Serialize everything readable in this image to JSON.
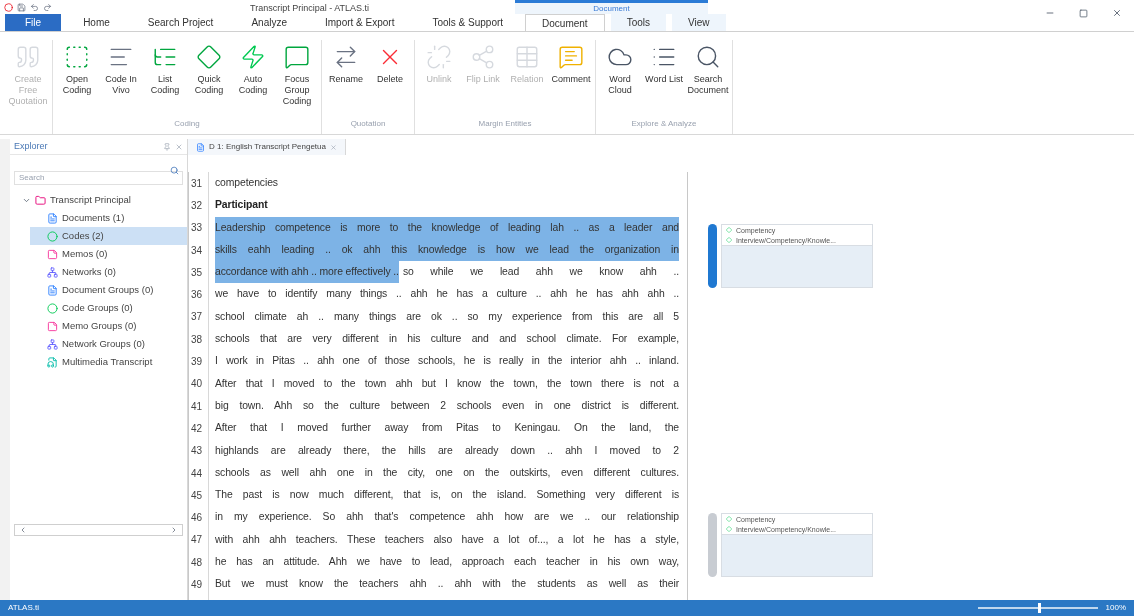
{
  "window": {
    "title": "Transcript Principal - ATLAS.ti",
    "context_label": "Document"
  },
  "tabs": [
    {
      "label": "File",
      "kind": "file",
      "selected": false
    },
    {
      "label": "Home",
      "kind": "tab",
      "selected": false
    },
    {
      "label": "Search Project",
      "kind": "tab",
      "selected": false
    },
    {
      "label": "Analyze",
      "kind": "tab",
      "selected": false
    },
    {
      "label": "Import & Export",
      "kind": "tab",
      "selected": false
    },
    {
      "label": "Tools & Support",
      "kind": "tab",
      "selected": false
    },
    {
      "label": "Document",
      "kind": "context",
      "selected": true
    },
    {
      "label": "Tools",
      "kind": "context",
      "selected": false
    },
    {
      "label": "View",
      "kind": "context",
      "selected": false
    }
  ],
  "ribbon": [
    {
      "buttons": [
        {
          "label": "Create Free Quotation",
          "disabled": true
        }
      ]
    },
    {
      "label": "Coding",
      "buttons": [
        {
          "label": "Open Coding",
          "disabled": false
        },
        {
          "label": "Code In Vivo",
          "disabled": false
        },
        {
          "label": "List Coding",
          "disabled": false
        },
        {
          "label": "Quick Coding",
          "disabled": false
        },
        {
          "label": "Auto Coding",
          "disabled": false
        },
        {
          "label": "Focus Group Coding",
          "disabled": false
        }
      ]
    },
    {
      "label": "Quotation",
      "buttons": [
        {
          "label": "Rename",
          "disabled": false
        },
        {
          "label": "Delete",
          "disabled": false
        }
      ]
    },
    {
      "label": "Margin Entities",
      "buttons": [
        {
          "label": "Unlink",
          "disabled": true
        },
        {
          "label": "Flip Link",
          "disabled": true
        },
        {
          "label": "Relation",
          "disabled": true
        },
        {
          "label": "Comment",
          "disabled": false
        }
      ]
    },
    {
      "label": "Explore & Analyze",
      "buttons": [
        {
          "label": "Word Cloud",
          "disabled": false
        },
        {
          "label": "Word List",
          "disabled": false
        },
        {
          "label": "Search Document",
          "disabled": false
        }
      ]
    }
  ],
  "explorer": {
    "title": "Explorer",
    "search": {
      "placeholder": "Search"
    },
    "tree": [
      {
        "label": "Transcript Principal",
        "expanded": true,
        "selected": false,
        "children": [
          {
            "label": "Documents (1)",
            "selected": false
          },
          {
            "label": "Codes (2)",
            "selected": true
          },
          {
            "label": "Memos (0)",
            "selected": false
          },
          {
            "label": "Networks (0)",
            "selected": false
          },
          {
            "label": "Document Groups (0)",
            "selected": false
          },
          {
            "label": "Code Groups (0)",
            "selected": false
          },
          {
            "label": "Memo Groups (0)",
            "selected": false
          },
          {
            "label": "Network Groups (0)",
            "selected": false
          },
          {
            "label": "Multimedia Transcript",
            "selected": false
          }
        ]
      }
    ]
  },
  "document": {
    "tab_title": "D 1: English Transcript Pengetua",
    "lines": [
      {
        "number": "31",
        "kind": "ending",
        "segments": [
          {
            "text": "competencies",
            "highlighted": false
          }
        ]
      },
      {
        "number": "32",
        "kind": "speaker",
        "segments": [
          {
            "text": "Participant",
            "highlighted": false
          }
        ]
      },
      {
        "number": "33",
        "kind": "text",
        "segments": [
          {
            "text": "Leadership competence is more to the knowledge of leading lah .. as a leader and",
            "highlighted": true
          }
        ]
      },
      {
        "number": "34",
        "kind": "text",
        "segments": [
          {
            "text": "skills eahh leading .. ok ahh this knowledge is how we lead the organization in",
            "highlighted": true
          }
        ]
      },
      {
        "number": "35",
        "kind": "text",
        "segments": [
          {
            "text": "accordance with ahh .. more effectively ..",
            "highlighted": true
          },
          {
            "text": "so while we lead ahh we know ahh ..",
            "highlighted": false
          }
        ]
      },
      {
        "number": "36",
        "kind": "text",
        "segments": [
          {
            "text": "we have to identify many things .. ahh he has a culture .. ahh he has ahh ahh ..",
            "highlighted": false
          }
        ]
      },
      {
        "number": "37",
        "kind": "text",
        "segments": [
          {
            "text": "school climate ah .. many things are ok .. so my experience from this are all 5",
            "highlighted": false
          }
        ]
      },
      {
        "number": "38",
        "kind": "text",
        "segments": [
          {
            "text": "schools that are very different in his culture and and school climate. For example,",
            "highlighted": false
          }
        ]
      },
      {
        "number": "39",
        "kind": "text",
        "segments": [
          {
            "text": "I work in Pitas .. ahh one of those schools, he is really in the interior ahh .. inland.",
            "highlighted": false
          }
        ]
      },
      {
        "number": "40",
        "kind": "text",
        "segments": [
          {
            "text": "After that I moved to the town ahh but I know the town, the town there is not a",
            "highlighted": false
          }
        ]
      },
      {
        "number": "41",
        "kind": "text",
        "segments": [
          {
            "text": "big town. Ahh so the culture between 2 schools even in one district is different.",
            "highlighted": false
          }
        ]
      },
      {
        "number": "42",
        "kind": "text",
        "segments": [
          {
            "text": "After that I moved further away from Pitas to Keningau. On the land, the",
            "highlighted": false
          }
        ]
      },
      {
        "number": "43",
        "kind": "text",
        "segments": [
          {
            "text": "highlands are already there, the hills are already down .. ahh I moved to 2",
            "highlighted": false
          }
        ]
      },
      {
        "number": "44",
        "kind": "text",
        "segments": [
          {
            "text": "schools as well ahh one in the city, one on the outskirts, even different cultures.",
            "highlighted": false
          }
        ]
      },
      {
        "number": "45",
        "kind": "text",
        "segments": [
          {
            "text": "The past is now much different, that is, on the island. Something very different is",
            "highlighted": false
          }
        ]
      },
      {
        "number": "46",
        "kind": "text",
        "segments": [
          {
            "text": "in my experience. So ahh that's competence ahh how are we .. our relationship",
            "highlighted": false
          }
        ]
      },
      {
        "number": "47",
        "kind": "text",
        "segments": [
          {
            "text": "with ahh ahh teachers. These teachers also have a lot of..., a lot he has a style,",
            "highlighted": false
          }
        ]
      },
      {
        "number": "48",
        "kind": "text",
        "segments": [
          {
            "text": "he has an attitude. Ahh we have to lead, approach each teacher in his own way,",
            "highlighted": false
          }
        ]
      },
      {
        "number": "49",
        "kind": "text",
        "segments": [
          {
            "text": "But we must know the teachers ahh .. ahh with the students as well as their",
            "highlighted": false
          }
        ]
      }
    ]
  },
  "margin": [
    {
      "selected": true,
      "codes": [
        "Competency",
        "Interview/Competency/Knowle..."
      ]
    },
    {
      "selected": false,
      "codes": [
        "Competency",
        "Interview/Competency/Knowle..."
      ]
    }
  ],
  "status_bar": {
    "label": "ATLAS.ti",
    "zoom": {
      "level": 0.5,
      "reading": "100%"
    }
  }
}
